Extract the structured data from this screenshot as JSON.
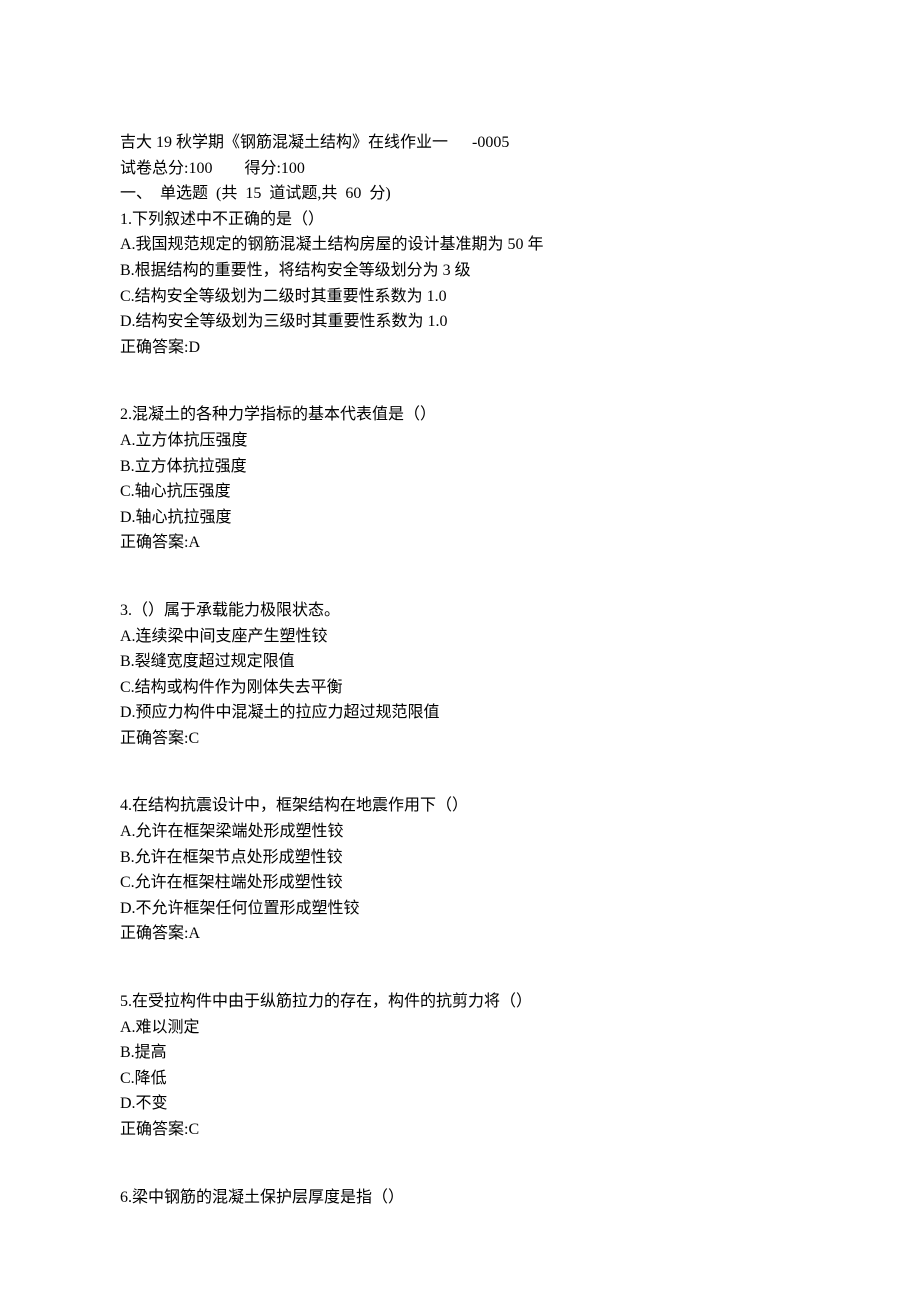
{
  "header": {
    "title": "吉大 19 秋学期《钢筋混凝土结构》在线作业一      -0005",
    "summary": "试卷总分:100        得分:100",
    "section": "一、  单选题  (共  15  道试题,共  60  分)"
  },
  "questions": [
    {
      "stem": "1.下列叙述中不正确的是（）",
      "options": [
        "A.我国规范规定的钢筋混凝土结构房屋的设计基准期为 50 年",
        "B.根据结构的重要性，将结构安全等级划分为 3 级",
        "C.结构安全等级划为二级时其重要性系数为 1.0",
        "D.结构安全等级划为三级时其重要性系数为 1.0"
      ],
      "answer": "正确答案:D"
    },
    {
      "stem": "2.混凝土的各种力学指标的基本代表值是（）",
      "options": [
        "A.立方体抗压强度",
        "B.立方体抗拉强度",
        "C.轴心抗压强度",
        "D.轴心抗拉强度"
      ],
      "answer": "正确答案:A"
    },
    {
      "stem": "3.（）属于承载能力极限状态。",
      "options": [
        "A.连续梁中间支座产生塑性铰",
        "B.裂缝宽度超过规定限值",
        "C.结构或构件作为刚体失去平衡",
        "D.预应力构件中混凝土的拉应力超过规范限值"
      ],
      "answer": "正确答案:C"
    },
    {
      "stem": "4.在结构抗震设计中，框架结构在地震作用下（）",
      "options": [
        "A.允许在框架梁端处形成塑性铰",
        "B.允许在框架节点处形成塑性铰",
        "C.允许在框架柱端处形成塑性铰",
        "D.不允许框架任何位置形成塑性铰"
      ],
      "answer": "正确答案:A"
    },
    {
      "stem": "5.在受拉构件中由于纵筋拉力的存在，构件的抗剪力将（）",
      "options": [
        "A.难以测定",
        "B.提高",
        "C.降低",
        "D.不变"
      ],
      "answer": "正确答案:C"
    },
    {
      "stem": "6.梁中钢筋的混凝土保护层厚度是指（）",
      "options": [],
      "answer": null
    }
  ]
}
